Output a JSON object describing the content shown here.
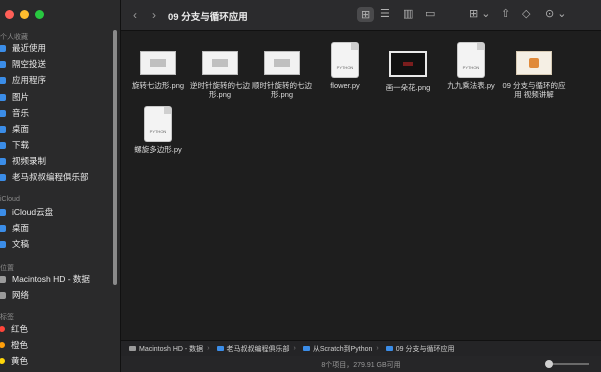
{
  "sidebar": {
    "sections": {
      "favorites": "个人收藏",
      "icloud": "iCloud",
      "locations": "位置",
      "tags": "标签"
    },
    "favorites": [
      {
        "label": "最近使用",
        "icon": "clock-icon"
      },
      {
        "label": "隔空投送",
        "icon": "airdrop-icon"
      },
      {
        "label": "应用程序",
        "icon": "applications-icon"
      },
      {
        "label": "图片",
        "icon": "pictures-icon"
      },
      {
        "label": "音乐",
        "icon": "music-icon"
      },
      {
        "label": "桌面",
        "icon": "desktop-icon"
      },
      {
        "label": "下载",
        "icon": "downloads-icon"
      },
      {
        "label": "视频录制",
        "icon": "folder-icon"
      },
      {
        "label": "老马叔叔编程俱乐部",
        "icon": "folder-icon"
      }
    ],
    "icloud": [
      {
        "label": "iCloud云盘",
        "icon": "cloud-icon"
      },
      {
        "label": "桌面",
        "icon": "desktop-icon"
      },
      {
        "label": "文稿",
        "icon": "documents-icon"
      }
    ],
    "locations": [
      {
        "label": "Macintosh HD - 数据",
        "icon": "disk-icon"
      },
      {
        "label": "网络",
        "icon": "network-icon"
      }
    ],
    "tags": [
      {
        "label": "红色",
        "color": "#ff453a"
      },
      {
        "label": "橙色",
        "color": "#ff9f0a"
      },
      {
        "label": "黄色",
        "color": "#ffd60a"
      }
    ]
  },
  "toolbar": {
    "title": "09 分支与循环应用",
    "back": "‹",
    "forward": "›",
    "view_icons": "⊞",
    "view_list": "☰",
    "view_columns": "▥",
    "view_gallery": "▭",
    "group": "⊞ ⌄",
    "share": "⇧",
    "tag": "◇",
    "more": "⊙ ⌄"
  },
  "files": [
    {
      "name": "旋转七边形.png",
      "kind": "image"
    },
    {
      "name": "逆时针旋转的七边形.png",
      "kind": "image"
    },
    {
      "name": "顺时针旋转的七边形.png",
      "kind": "image"
    },
    {
      "name": "flower.py",
      "kind": "python"
    },
    {
      "name": "画一朵花.png",
      "kind": "dark-image"
    },
    {
      "name": "九九乘法表.py",
      "kind": "python"
    },
    {
      "name": "09 分支与循环的应用 视频讲解",
      "kind": "video"
    },
    {
      "name": "螺旋多边形.py",
      "kind": "python"
    }
  ],
  "python_badge": "PYTHON",
  "pathbar": [
    "Macintosh HD - 数据",
    "老马叔叔编程俱乐部",
    "从Scratch到Python",
    "09 分支与循环应用"
  ],
  "status": "8个项目，279.91 GB可用",
  "colors": {
    "accent": "#3b8de8",
    "close": "#ff5f57",
    "minimize": "#febc2e",
    "zoom": "#28c840"
  }
}
